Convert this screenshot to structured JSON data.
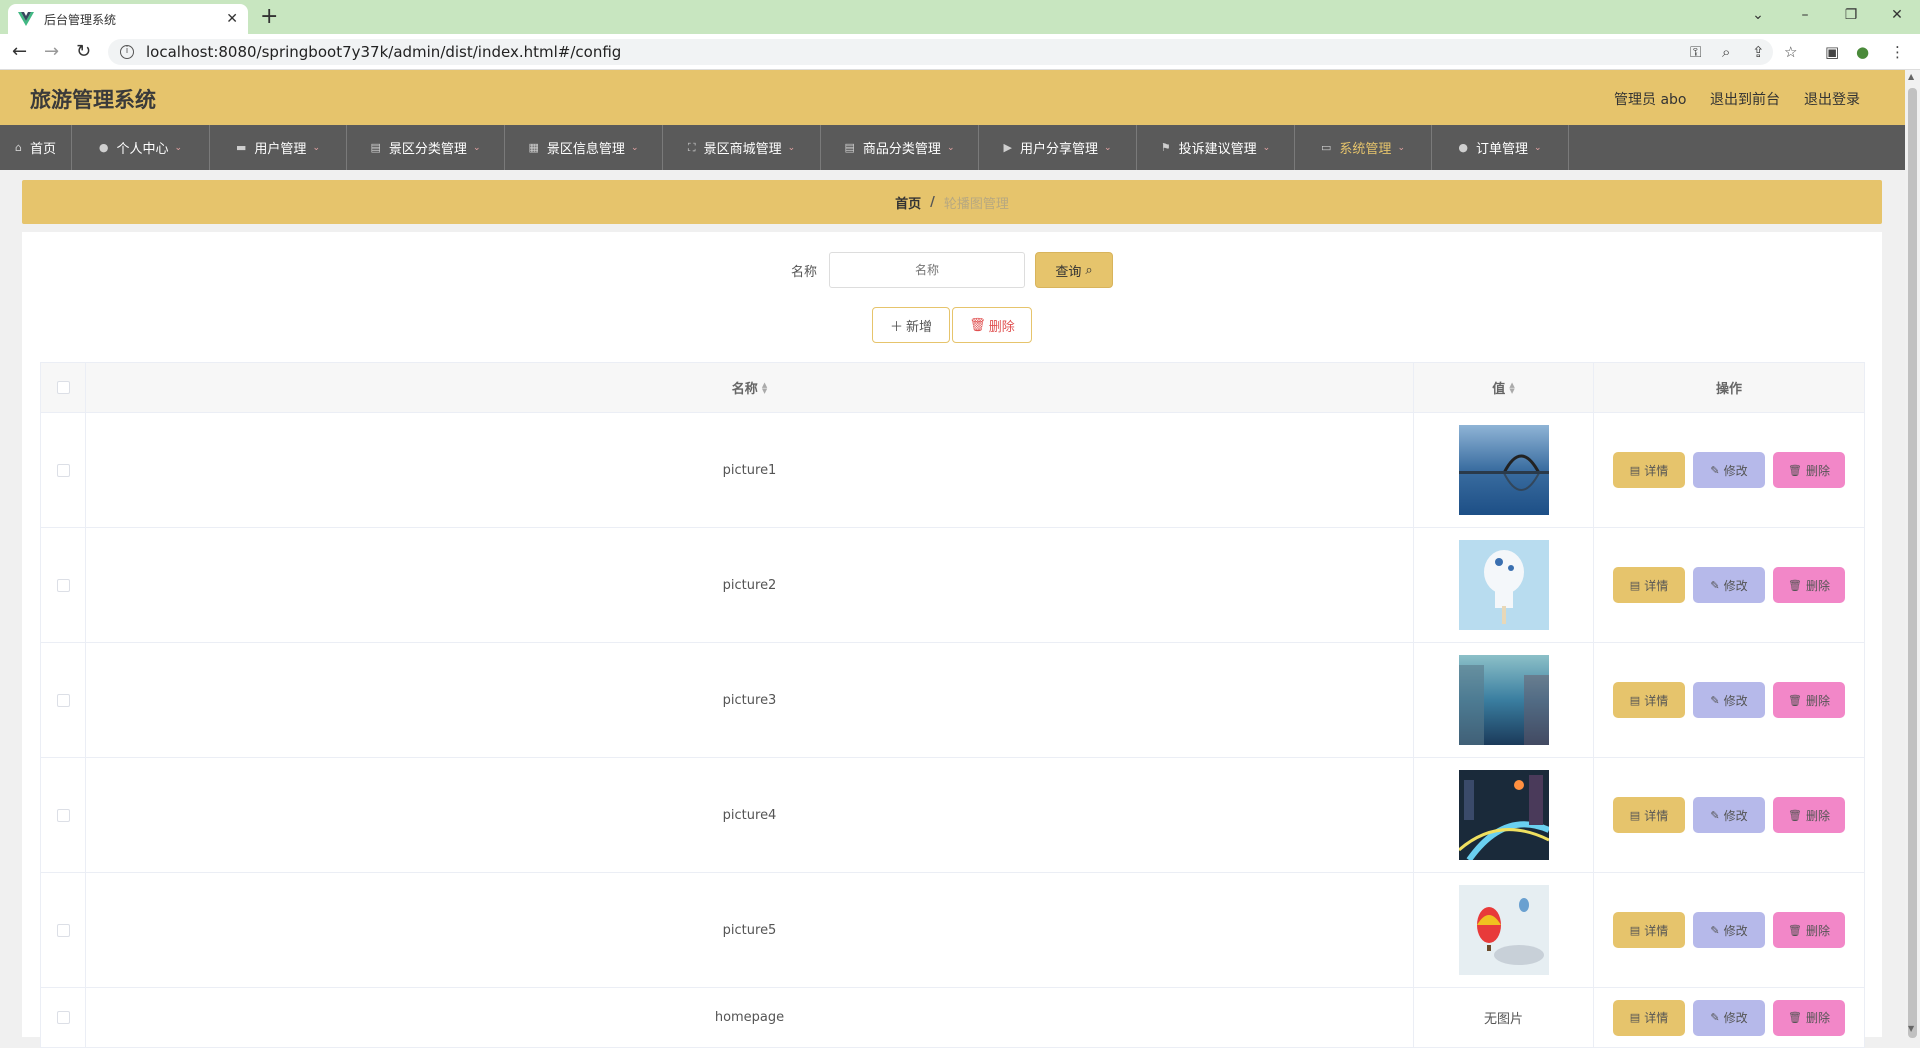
{
  "browser": {
    "tab_title": "后台管理系统",
    "new_tab": "+",
    "url": "localhost:8080/springboot7y37k/admin/dist/index.html#/config"
  },
  "header": {
    "title": "旅游管理系统",
    "admin_label": "管理员 abo",
    "to_front": "退出到前台",
    "logout": "退出登录"
  },
  "menu": [
    {
      "label": "首页",
      "icon": "home-icon",
      "arrow": false,
      "active": false
    },
    {
      "label": "个人中心",
      "icon": "user-icon",
      "arrow": true,
      "active": false
    },
    {
      "label": "用户管理",
      "icon": "briefcase-icon",
      "arrow": true,
      "active": false
    },
    {
      "label": "景区分类管理",
      "icon": "clipboard-icon",
      "arrow": true,
      "active": false
    },
    {
      "label": "景区信息管理",
      "icon": "grid-icon",
      "arrow": true,
      "active": false
    },
    {
      "label": "景区商城管理",
      "icon": "fullscreen-icon",
      "arrow": true,
      "active": false
    },
    {
      "label": "商品分类管理",
      "icon": "clipboard-icon",
      "arrow": true,
      "active": false
    },
    {
      "label": "用户分享管理",
      "icon": "video-icon",
      "arrow": true,
      "active": false
    },
    {
      "label": "投诉建议管理",
      "icon": "flag-icon",
      "arrow": true,
      "active": false
    },
    {
      "label": "系统管理",
      "icon": "monitor-icon",
      "arrow": true,
      "active": true
    },
    {
      "label": "订单管理",
      "icon": "user-icon",
      "arrow": true,
      "active": false
    }
  ],
  "breadcrumb": {
    "home": "首页",
    "separator": "/",
    "current": "轮播图管理"
  },
  "search": {
    "label": "名称",
    "placeholder": "名称",
    "button": "查询"
  },
  "actions": {
    "add": "新增",
    "delete": "删除"
  },
  "table": {
    "columns": {
      "name": "名称",
      "value": "值",
      "ops": "操作"
    },
    "ops": {
      "detail": "详情",
      "edit": "修改",
      "delete": "删除"
    },
    "rows": [
      {
        "name": "picture1",
        "value": "image",
        "img": "bridge"
      },
      {
        "name": "picture2",
        "value": "image",
        "img": "icecream"
      },
      {
        "name": "picture3",
        "value": "image",
        "img": "blur"
      },
      {
        "name": "picture4",
        "value": "image",
        "img": "city"
      },
      {
        "name": "picture5",
        "value": "image",
        "img": "balloon"
      },
      {
        "name": "homepage",
        "value": "无图片",
        "img": null
      }
    ]
  },
  "colors": {
    "accent": "#e6c46c",
    "menu_bg": "#5a5a5a",
    "edit": "#b6b9ea",
    "delete": "#f287c8"
  }
}
